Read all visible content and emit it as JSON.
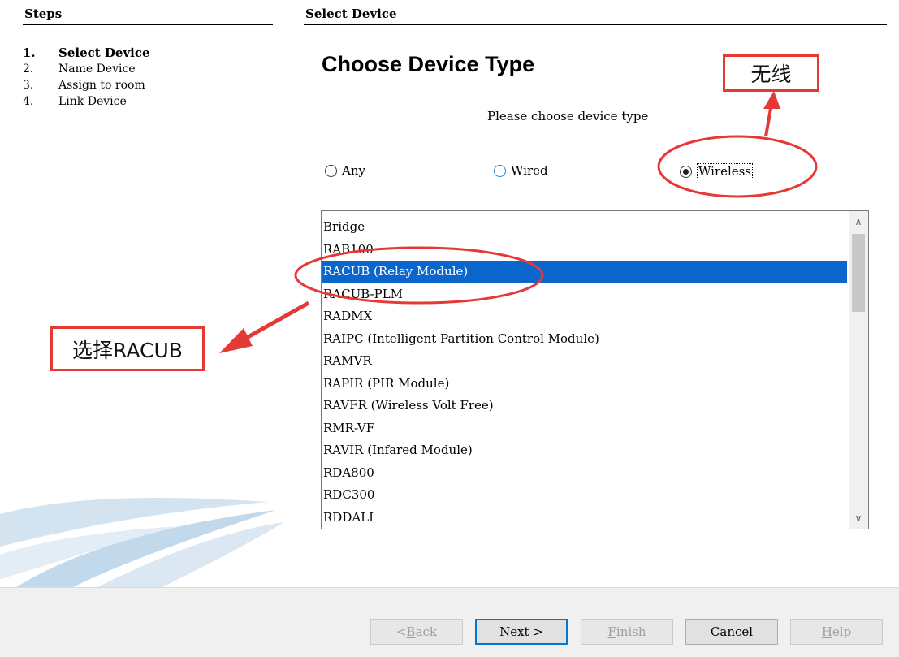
{
  "left": {
    "title": "Steps",
    "steps": [
      {
        "num": "1.",
        "label": "Select Device"
      },
      {
        "num": "2.",
        "label": "Name Device"
      },
      {
        "num": "3.",
        "label": "Assign to room"
      },
      {
        "num": "4.",
        "label": "Link Device"
      }
    ]
  },
  "main": {
    "header": "Select Device",
    "title": "Choose Device Type",
    "instruction": "Please choose device type",
    "radios": {
      "any": "Any",
      "wired": "Wired",
      "wireless": "Wireless",
      "selected": "Wireless"
    },
    "devices": [
      "Bridge",
      "RAB100",
      "RACUB (Relay Module)",
      "RACUB-PLM",
      "RADMX",
      "RAIPC (Intelligent Partition Control Module)",
      "RAMVR",
      "RAPIR (PIR Module)",
      "RAVFR (Wireless Volt Free)",
      "RMR-VF",
      "RAVIR (Infared Module)",
      "RDA800",
      "RDC300",
      "RDDALI"
    ],
    "selected_device": "RACUB (Relay Module)"
  },
  "footer": {
    "back": {
      "accel": "B",
      "rest": "ack",
      "prefix": "< "
    },
    "next": "Next >",
    "finish": {
      "accel": "F",
      "rest": "inish"
    },
    "cancel": "Cancel",
    "help": {
      "accel": "H",
      "rest": "elp"
    }
  },
  "annotations": {
    "wireless_note": "无线",
    "select_note": "选择RACUB",
    "color": "#e53935"
  },
  "colors": {
    "selection": "#0a66cc",
    "default_button_border": "#0078d7"
  }
}
